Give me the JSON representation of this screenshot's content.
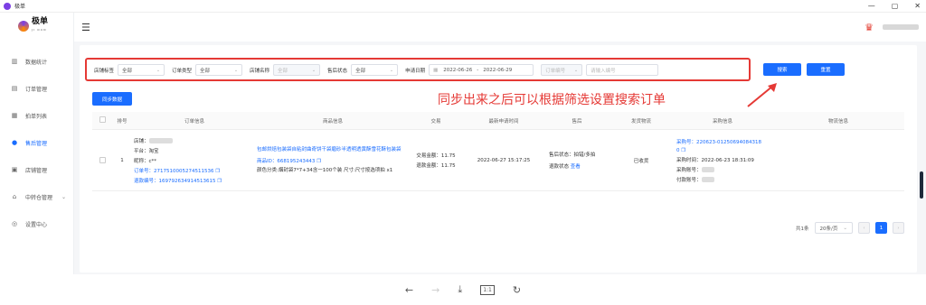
{
  "window": {
    "title": "极单",
    "controls": [
      "—",
      "▢",
      "✕"
    ]
  },
  "brand": {
    "name": "极单",
    "sub": "JI DAN"
  },
  "sidebar": {
    "items": [
      {
        "label": "数据统计",
        "icon": "bar-chart-icon",
        "glyph": "▥"
      },
      {
        "label": "订单管理",
        "icon": "list-icon",
        "glyph": "▤"
      },
      {
        "label": "拍单列表",
        "icon": "clipboard-icon",
        "glyph": "▦"
      },
      {
        "label": "售后管理",
        "icon": "user-icon",
        "glyph": "●"
      },
      {
        "label": "店铺管理",
        "icon": "shop-icon",
        "glyph": "▣"
      },
      {
        "label": "中转仓管理",
        "icon": "warehouse-icon",
        "glyph": "⌂"
      },
      {
        "label": "设置中心",
        "icon": "settings-icon",
        "glyph": "◎"
      }
    ]
  },
  "filters": {
    "shop_tag_label": "店铺标签",
    "shop_tag_value": "全部",
    "order_type_label": "订单类型",
    "order_type_value": "全部",
    "shop_name_label": "店铺名称",
    "shop_name_value": "全部",
    "after_sale_label": "售后状态",
    "after_sale_value": "全部",
    "apply_date_label": "申请日期",
    "date_start": "2022-06-26",
    "date_sep": "-",
    "date_end": "2022-06-29",
    "order_no_select": "订单编号",
    "order_no_placeholder": "请输入编号"
  },
  "buttons": {
    "search": "搜索",
    "reset": "重置",
    "sync": "同步数据"
  },
  "annotation": "同步出来之后可以根据筛选设置搜索订单",
  "table": {
    "headers": [
      "排号",
      "订单信息",
      "商品信息",
      "交易",
      "最新申请时间",
      "售后",
      "发货物流",
      "采购信息",
      "物流信息"
    ],
    "row": {
      "index": "1",
      "shop": "店铺：",
      "platform": "平台：淘宝",
      "nickname": "昵称：c**",
      "order_no": "订单号：2717510005274511536",
      "refund_no": "退款编号：169792634914513615",
      "product_title": "包邮烘焙包装袋自粘封曲奇饼干袋磨砂半透明透黄酥雪花酥包装袋",
      "product_id": "商品ID：668195243443",
      "product_spec": "颜色分类:烟封袋7*7+34含一100个装 尺寸:尺寸按选项拍 x1",
      "trade_amount": "交易金额：11.75",
      "refund_amount": "退款金额：11.75",
      "apply_time": "2022-06-27 15:17:25",
      "after_sale_status": "售后状态：拍错/多拍",
      "refund_status": "退款状态",
      "refund_view": "查看",
      "shipping": "已收货",
      "purchase_no": "采购号：220623-01250694084318",
      "purchase_no_suffix": "0",
      "purchase_time": "采购时间：2022-06-23 18:31:09",
      "purchase_account": "采购账号：",
      "payment_no": "付款账号："
    }
  },
  "pagination": {
    "total": "共1条",
    "page_size": "20条/页",
    "current": "1",
    "prev": "‹",
    "next": "›"
  },
  "viewer": {
    "back": "←",
    "forward": "→",
    "download": "⤓",
    "actual_size": "1:1",
    "rotate": "↻"
  }
}
